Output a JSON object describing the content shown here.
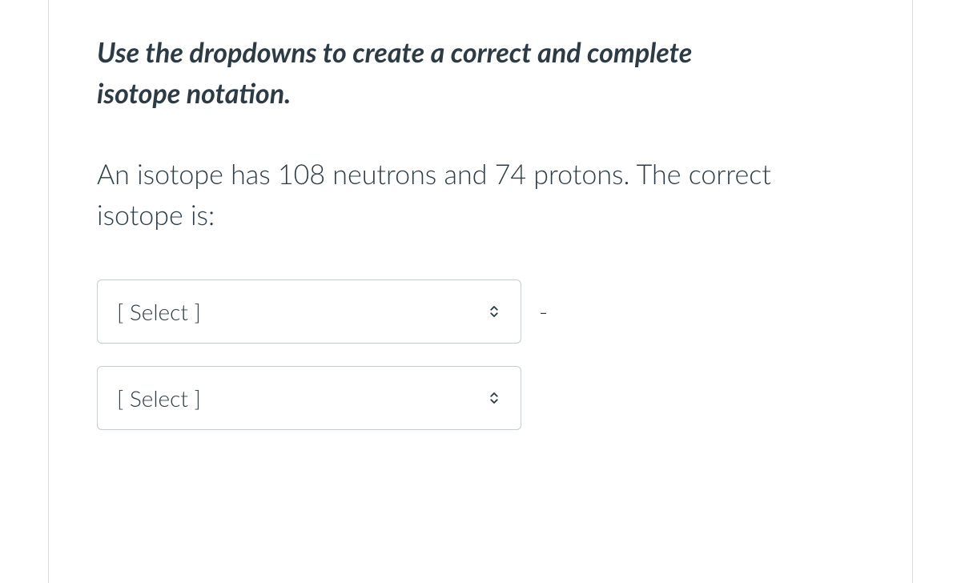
{
  "instruction": "Use the dropdowns to create a correct and complete isotope notation.",
  "question_text": "An isotope has 108 neutrons and 74 protons. The correct isotope is:",
  "dropdowns": {
    "first": {
      "label": "[ Select ]"
    },
    "second": {
      "label": "[ Select ]"
    }
  },
  "separator": "-"
}
